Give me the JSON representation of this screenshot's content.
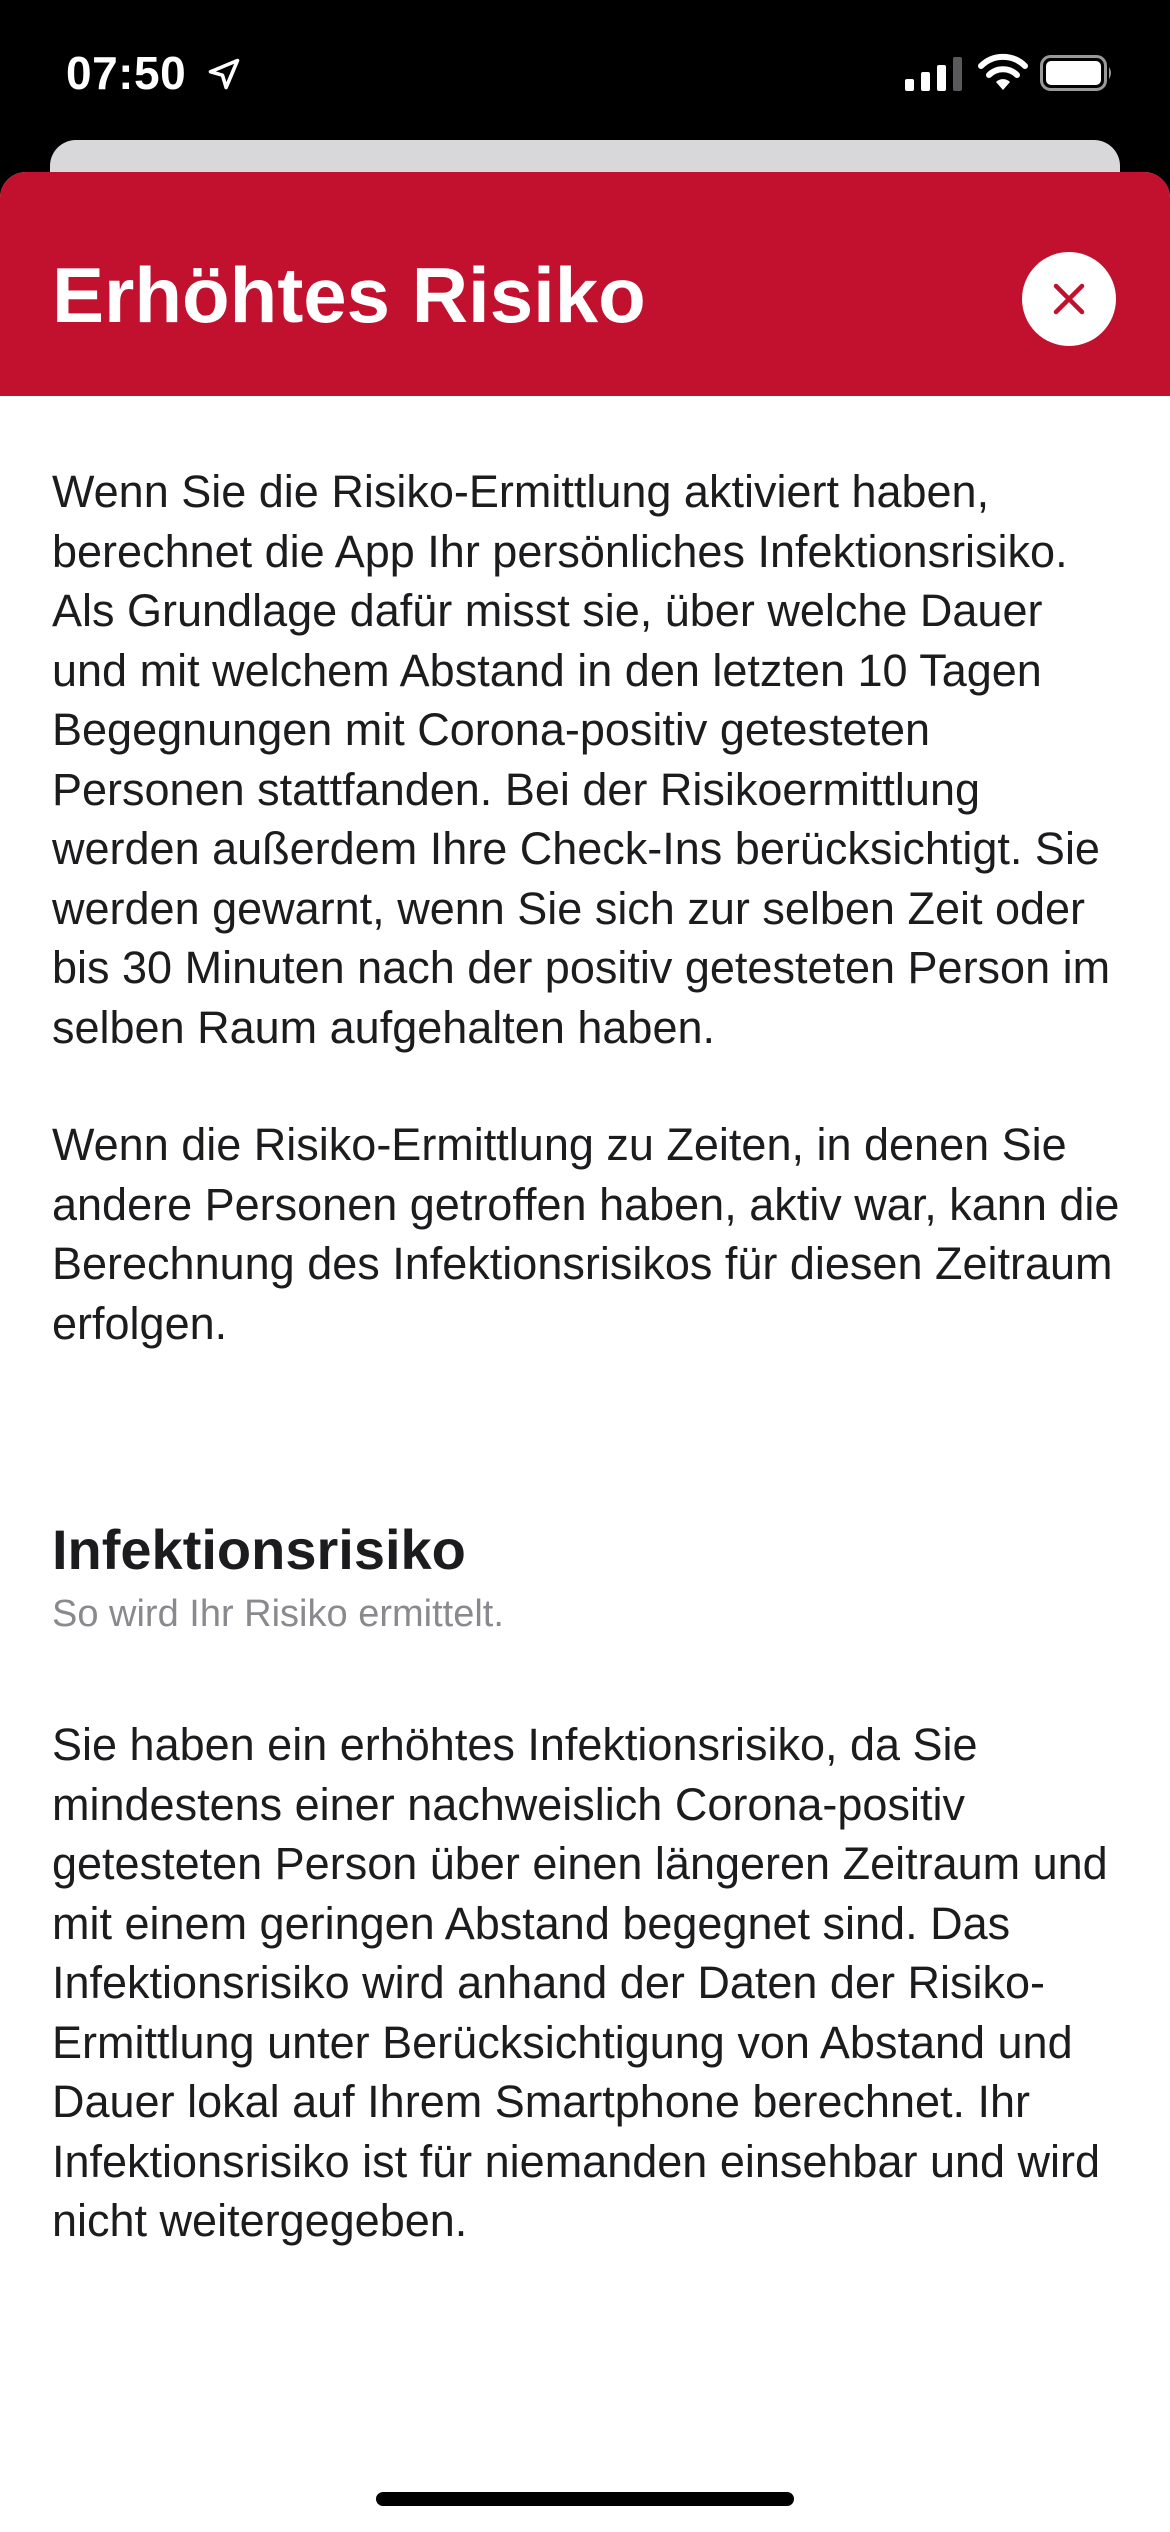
{
  "status_bar": {
    "time": "07:50",
    "icons": [
      "location-arrow-icon",
      "cellular-signal-icon",
      "wifi-icon",
      "battery-icon"
    ]
  },
  "header": {
    "title": "Erhöhtes Risiko",
    "background_color": "#c1112f",
    "close_icon": "close-icon"
  },
  "content": {
    "paragraph_1": "Wenn Sie die Risiko-Ermittlung aktiviert haben, berechnet die App Ihr persönliches Infektionsrisiko. Als Grundlage dafür misst sie, über welche Dauer und mit welchem Abstand in den letzten 10 Tagen Begegnungen mit Corona-positiv getesteten Personen stattfanden. Bei der Risikoermittlung werden außerdem Ihre Check-Ins berücksichtigt. Sie werden gewarnt, wenn Sie sich zur selben Zeit oder bis 30 Minuten nach der positiv getesteten Person im selben Raum aufgehalten haben.",
    "paragraph_2": "Wenn die Risiko-Ermittlung zu Zeiten, in denen Sie andere Personen getroffen haben, aktiv war, kann die Berechnung des Infektionsrisikos für diesen Zeitraum erfolgen.",
    "section_title": "Infektionsrisiko",
    "section_subtitle": "So wird Ihr Risiko ermittelt.",
    "paragraph_3": "Sie haben ein erhöhtes Infektionsrisiko, da Sie mindestens einer nachweislich Corona-positiv getesteten Person über einen längeren Zeitraum und mit einem geringen Abstand begegnet sind. Das Infektionsrisiko wird anhand der Daten der Risiko-Ermittlung unter Berücksichtigung von Abstand und Dauer lokal auf Ihrem Smartphone berechnet. Ihr Infektionsrisiko ist für niemanden einsehbar und wird nicht weitergegeben."
  }
}
